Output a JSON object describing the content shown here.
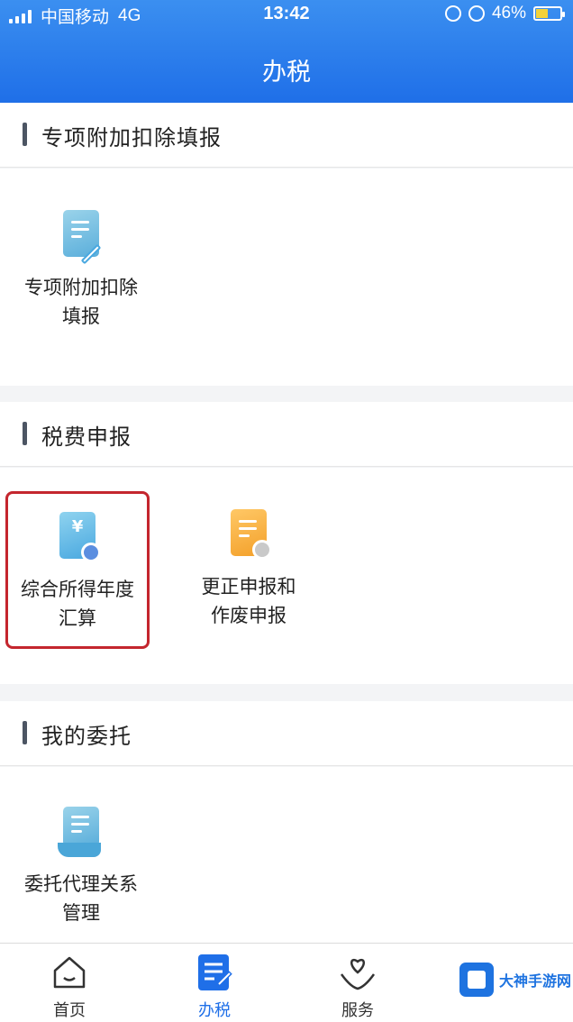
{
  "status_bar": {
    "carrier": "中国移动",
    "network": "4G",
    "time": "13:42",
    "battery": "46%"
  },
  "header": {
    "title": "办税"
  },
  "sections": [
    {
      "title": "专项附加扣除填报",
      "items": [
        {
          "label": "专项附加扣除\n填报",
          "icon": "document-edit-icon"
        }
      ]
    },
    {
      "title": "税费申报",
      "items": [
        {
          "label": "综合所得年度\n汇算",
          "icon": "tax-document-icon",
          "highlighted": true
        },
        {
          "label": "更正申报和\n作废申报",
          "icon": "correction-document-icon"
        }
      ]
    },
    {
      "title": "我的委托",
      "items": [
        {
          "label": "委托代理关系\n管理",
          "icon": "entrust-document-icon"
        }
      ]
    }
  ],
  "tabbar": [
    {
      "label": "首页",
      "icon": "home-icon",
      "active": false
    },
    {
      "label": "办税",
      "icon": "tax-icon",
      "active": true
    },
    {
      "label": "服务",
      "icon": "heart-hand-icon",
      "active": false
    }
  ],
  "watermark": {
    "text": "大神手游网"
  },
  "colors": {
    "primary": "#1f6fe8",
    "highlight_border": "#c4262e",
    "icon_blue": "#49a8e0",
    "icon_orange": "#f3a02a"
  }
}
